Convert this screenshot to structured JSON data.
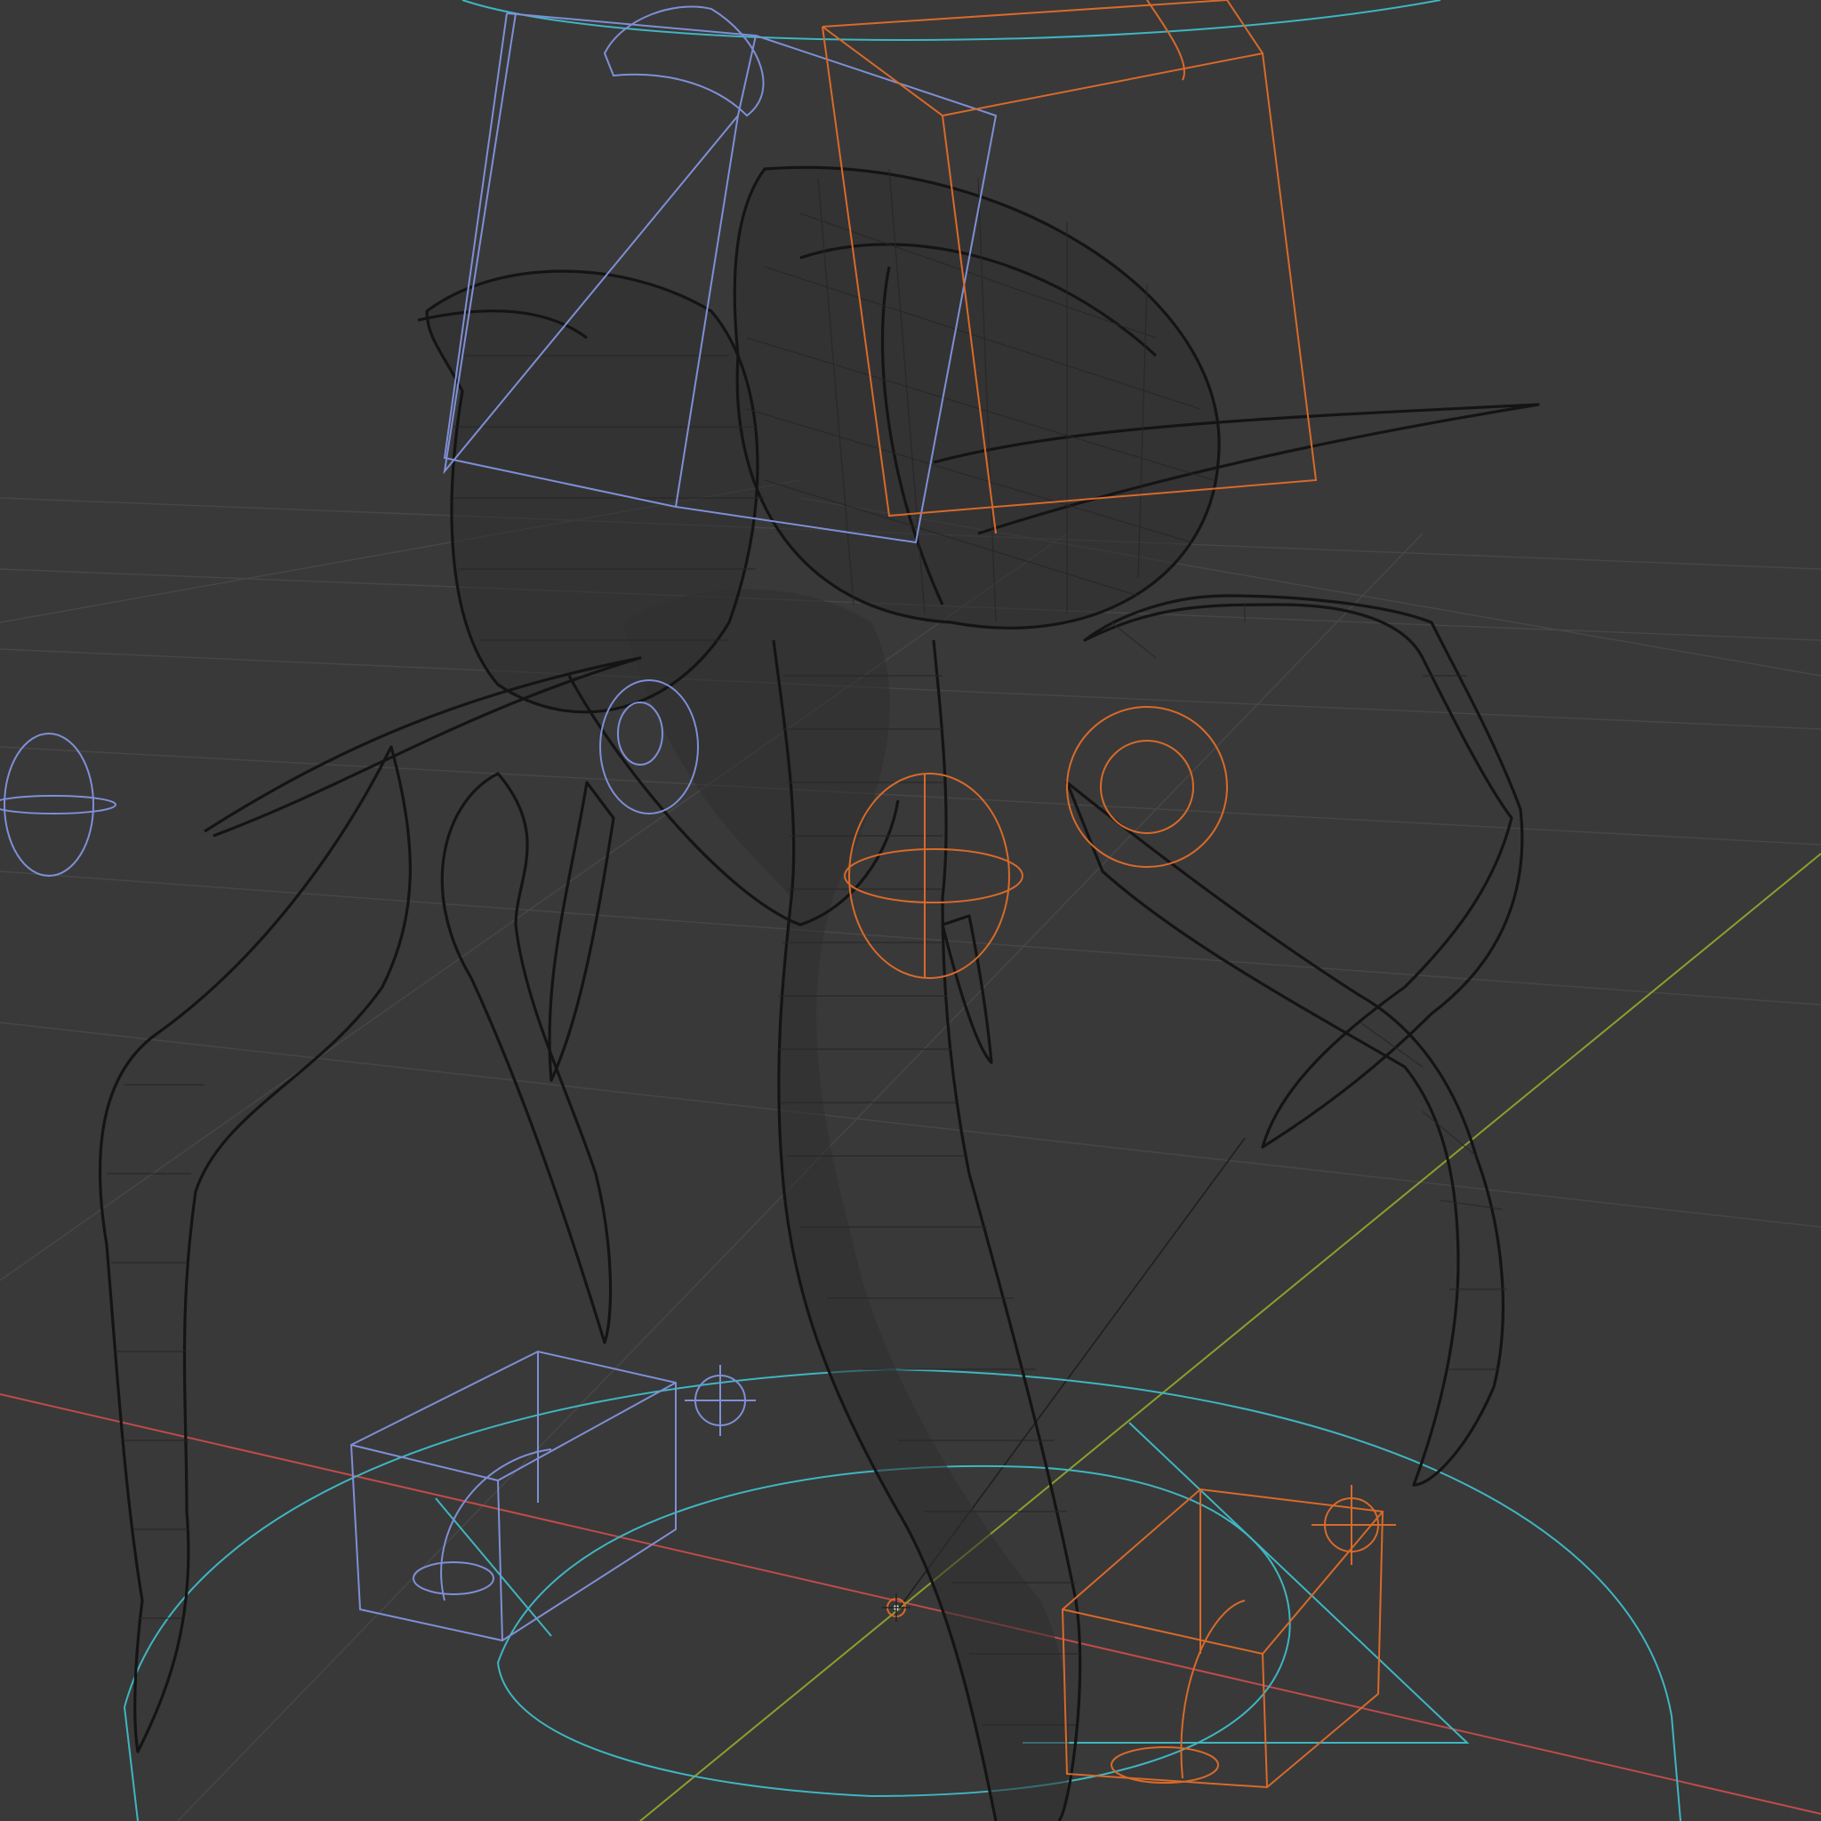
{
  "viewport": {
    "mode": "wireframe",
    "background": "#393939",
    "colors": {
      "grid": "#474747",
      "mesh_wire": "#141414",
      "x_axis": "#c04b4b",
      "y_axis": "#8aa02c",
      "selected_controls": "#d86a2a",
      "bone_controls": "#7f8fd6",
      "root_controls": "#3fb6c2"
    },
    "objects": [
      {
        "name": "spider-creature-mesh"
      },
      {
        "name": "body-box-control"
      },
      {
        "name": "head-box-control"
      },
      {
        "name": "root-circle-control"
      },
      {
        "name": "left-foot-box-control"
      },
      {
        "name": "right-foot-box-control"
      },
      {
        "name": "hip-sphere-control"
      },
      {
        "name": "world-origin-cursor"
      }
    ]
  }
}
